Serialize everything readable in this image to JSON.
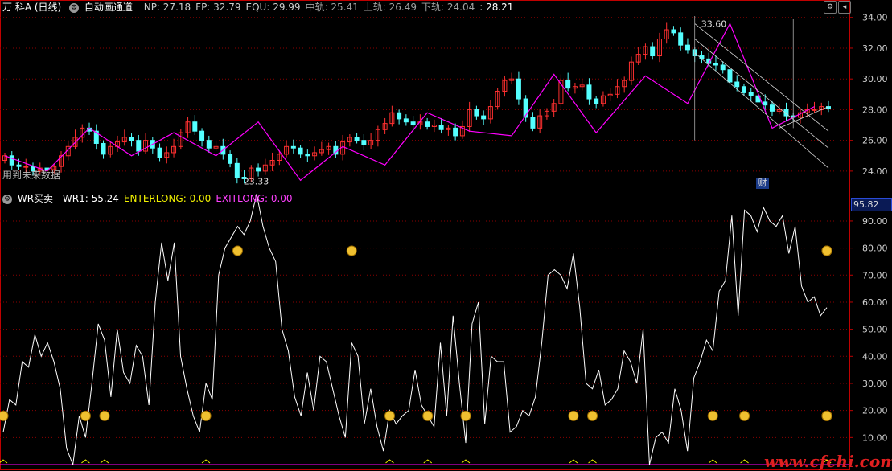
{
  "top_header": {
    "stock_name": "万 科A",
    "period": "(日线)",
    "indicator_name": "自动画通道",
    "fields": [
      {
        "label": "NP:",
        "value": "27.18",
        "color": "#cccccc"
      },
      {
        "label": "FP:",
        "value": "32.79",
        "color": "#cccccc"
      },
      {
        "label": "EQU:",
        "value": "29.99",
        "color": "#cccccc"
      },
      {
        "label": "中轨:",
        "value": "25.41",
        "color": "#a0a0a0"
      },
      {
        "label": "上轨:",
        "value": "26.49",
        "color": "#a0a0a0"
      },
      {
        "label": "下轨:",
        "value": "24.04",
        "color": "#a0a0a0"
      },
      {
        "label": ":",
        "value": "28.21",
        "color": "#ffffff"
      }
    ],
    "future_data_note": "用到未来数据"
  },
  "bottom_header": {
    "indicator_name": "WR买卖",
    "fields": [
      {
        "label": "WR1:",
        "value": "55.24",
        "color": "#ffffff"
      },
      {
        "label": "ENTERLONG:",
        "value": "0.00",
        "color": "#f0f000"
      },
      {
        "label": "EXITLONG:",
        "value": "0.00",
        "color": "#ff40ff"
      }
    ]
  },
  "buttons": {
    "gear": "⚙",
    "toggle": "◂"
  },
  "value_box": "95.82",
  "cai_badge": "财",
  "watermark": "www.cfchi.com",
  "colors": {
    "up": "#ff3030",
    "down": "#54ffff",
    "zigzag": "#ff00ff",
    "channel": "#d8d8d8",
    "grid": "#8b0000",
    "axis": "#c00000",
    "wr": "#ffffff"
  },
  "chart_data": [
    {
      "type": "candlestick",
      "title": "万 科A (日线)",
      "y_ticks": [
        24.0,
        26.0,
        28.0,
        30.0,
        32.0,
        34.0
      ],
      "ylim": [
        23.0,
        34.3
      ],
      "labels": [
        {
          "text": "33.60",
          "value": 33.6
        },
        {
          "text": "23.33",
          "value": 23.33
        }
      ],
      "closes": [
        25.0,
        24.4,
        24.3,
        24.3,
        24.0,
        24.2,
        24.1,
        24.3,
        25.0,
        25.6,
        26.2,
        26.8,
        26.6,
        25.8,
        25.1,
        25.6,
        25.9,
        26.2,
        26.0,
        25.3,
        26.0,
        25.5,
        24.9,
        25.2,
        25.6,
        26.5,
        27.2,
        26.6,
        26.0,
        25.5,
        25.6,
        25.1,
        24.5,
        23.6,
        23.5,
        24.2,
        24.0,
        24.4,
        24.7,
        25.1,
        25.6,
        25.5,
        25.1,
        25.0,
        25.2,
        25.4,
        25.6,
        25.1,
        25.9,
        26.2,
        26.0,
        25.7,
        26.0,
        26.7,
        27.1,
        27.8,
        27.4,
        27.2,
        27.0,
        27.2,
        26.9,
        27.0,
        26.7,
        26.8,
        26.3,
        26.9,
        28.0,
        27.6,
        27.4,
        28.2,
        29.2,
        29.9,
        30.0,
        28.7,
        27.5,
        26.8,
        27.6,
        27.9,
        28.4,
        29.9,
        29.4,
        29.5,
        29.6,
        28.7,
        28.4,
        28.9,
        29.0,
        29.5,
        29.9,
        31.1,
        31.6,
        32.1,
        31.5,
        32.6,
        33.2,
        33.0,
        32.2,
        31.9,
        31.5,
        31.3,
        31.0,
        30.9,
        30.6,
        29.8,
        29.5,
        29.1,
        28.9,
        28.5,
        28.3,
        27.9,
        28.0,
        27.6,
        27.5,
        27.8,
        28.0,
        28.0,
        28.2,
        28.1
      ],
      "zigzag_values": [
        25.0,
        24.0,
        26.8,
        25.0,
        26.5,
        25.0,
        27.2,
        23.4,
        25.6,
        24.4,
        27.8,
        26.6,
        26.3,
        30.3,
        26.5,
        30.2,
        28.4,
        33.6,
        26.8,
        28.2
      ],
      "channel": [
        {
          "from": 33.6,
          "to": 26.6
        },
        {
          "from": 32.6,
          "to": 25.5
        },
        {
          "from": 31.7,
          "to": 24.2
        },
        {
          "from": 26.8,
          "to": 28.2
        }
      ]
    },
    {
      "type": "line",
      "title": "WR买卖",
      "y_ticks": [
        10.0,
        20.0,
        30.0,
        40.0,
        50.0,
        60.0,
        70.0,
        80.0,
        90.0
      ],
      "ylim": [
        0,
        98
      ],
      "series": [
        {
          "name": "WR1",
          "values": [
            12,
            24,
            22,
            38,
            36,
            48,
            40,
            45,
            38,
            28,
            6,
            0,
            18,
            10,
            30,
            52,
            46,
            25,
            50,
            34,
            30,
            44,
            40,
            22,
            60,
            82,
            68,
            82,
            40,
            28,
            18,
            12,
            30,
            24,
            70,
            80,
            84,
            88,
            85,
            90,
            100,
            88,
            80,
            75,
            50,
            42,
            25,
            18,
            34,
            20,
            40,
            38,
            28,
            18,
            10,
            45,
            40,
            15,
            28,
            14,
            5,
            20,
            15,
            18,
            20,
            35,
            22,
            18,
            14,
            45,
            18,
            55,
            30,
            8,
            52,
            60,
            15,
            40,
            38,
            38,
            12,
            14,
            20,
            18,
            25,
            45,
            70,
            72,
            70,
            65,
            78,
            58,
            30,
            28,
            35,
            22,
            24,
            28,
            42,
            38,
            30,
            50,
            0,
            10,
            12,
            8,
            28,
            20,
            5,
            32,
            38,
            46,
            42,
            64,
            68,
            92,
            55,
            94,
            92,
            86,
            95,
            90,
            88,
            92,
            78,
            88,
            66,
            60,
            62,
            55,
            58
          ]
        }
      ],
      "enterlong_markers": [
        0,
        13,
        16,
        32,
        61,
        67,
        73,
        90,
        93,
        112,
        117,
        150,
        153,
        167
      ],
      "exitlong_markers": [
        37,
        55,
        214,
        238,
        242
      ]
    }
  ]
}
